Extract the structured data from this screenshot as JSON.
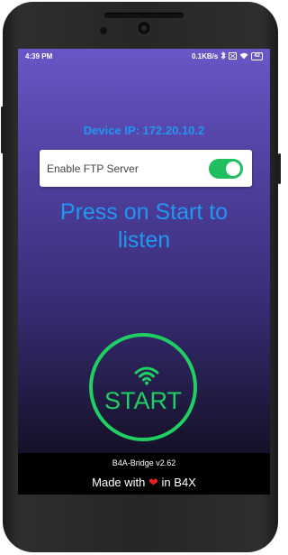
{
  "status_bar": {
    "time": "4:39 PM",
    "network_speed": "0.1KB/s",
    "battery": "42"
  },
  "main": {
    "device_ip": "Device IP: 172.20.10.2",
    "ftp_label": "Enable FTP Server",
    "ftp_enabled": true,
    "press_text": "Press on Start to listen",
    "start_label": "START"
  },
  "footer": {
    "version": "B4A-Bridge v2.62",
    "made_with_prefix": "Made with",
    "made_with_suffix": "in B4X"
  },
  "colors": {
    "accent_blue": "#2196f3",
    "accent_green": "#1fcf62",
    "heart_red": "#e02424"
  },
  "icons": [
    "wifi-icon",
    "bluetooth-icon",
    "signal-icon",
    "battery-icon",
    "heart-icon"
  ]
}
